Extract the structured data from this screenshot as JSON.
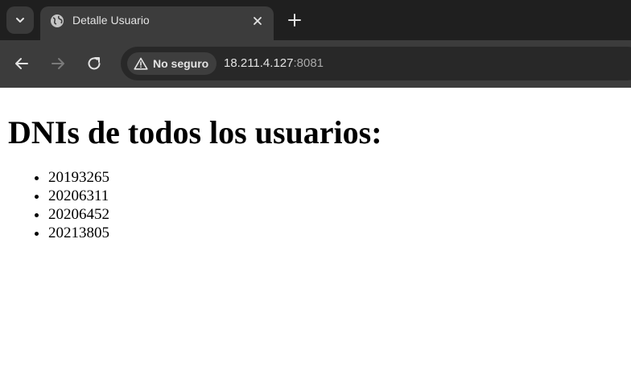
{
  "browser": {
    "tab": {
      "title": "Detalle Usuario"
    },
    "address_bar": {
      "security_label": "No seguro",
      "url_host": "18.211.4.127",
      "url_port": ":8081"
    }
  },
  "page": {
    "heading": "DNIs de todos los usuarios:",
    "dnis": [
      "20193265",
      "20206311",
      "20206452",
      "20213805"
    ]
  }
}
